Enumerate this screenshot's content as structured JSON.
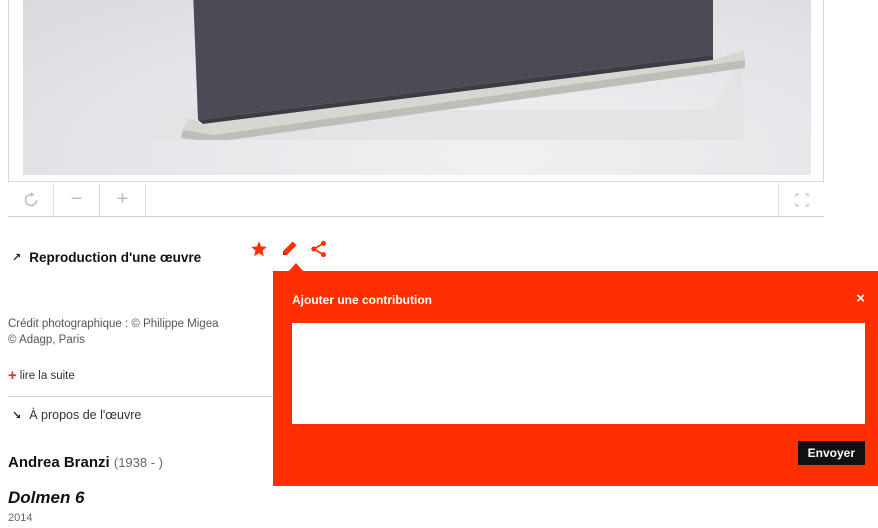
{
  "viewer": {
    "image_alt": "",
    "controls": {
      "reset_icon": "rotate-reset-icon",
      "zoom_out_label": "−",
      "zoom_in_label": "+",
      "fullscreen_icon": "fullscreen-icon"
    }
  },
  "artwork_header": {
    "title": "Reproduction d'une œuvre",
    "arrow_icon": "north-east-arrow-icon",
    "actions": [
      {
        "name": "favorite",
        "icon": "star-icon",
        "color": "#ff2f00"
      },
      {
        "name": "contribute",
        "icon": "pencil-icon",
        "color": "#ff2f00"
      },
      {
        "name": "share",
        "icon": "share-icon",
        "color": "#ff2f00"
      }
    ]
  },
  "credit": {
    "line1": "Crédit photographique : © Philippe Migea",
    "line2": "© Adagp, Paris"
  },
  "read_more": {
    "label": "lire la suite"
  },
  "about": {
    "label": "À propos de l'œuvre"
  },
  "artist": {
    "name": "Andrea Branzi",
    "dates": "(1938 - )"
  },
  "work": {
    "title": "Dolmen 6",
    "year": "2014"
  },
  "contribution_popup": {
    "title": "Ajouter une contribution",
    "close_label": "×",
    "textarea_value": "",
    "textarea_placeholder": "",
    "send_label": "Envoyer",
    "background_color": "#ff2f00"
  }
}
